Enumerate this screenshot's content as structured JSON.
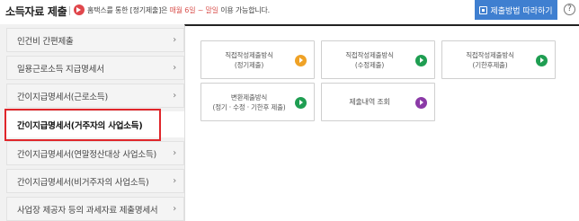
{
  "header": {
    "title": "소득자료 제출",
    "notice": {
      "prefix": "홈택스를 통한 [정기제출]은 ",
      "highlight": "매월 6일 ~ 말일",
      "suffix": " 이용 가능합니다."
    },
    "method_button": "제출방법 따라하기",
    "help_icon": "?"
  },
  "sidebar": {
    "items": [
      {
        "label": "인건비 간편제출",
        "active": false
      },
      {
        "label": "일용근로소득 지급명세서",
        "active": false
      },
      {
        "label": "간이지급명세서(근로소득)",
        "active": false
      },
      {
        "label": "간이지급명세서(거주자의 사업소득)",
        "active": true
      },
      {
        "label": "간이지급명세서(연말정산대상 사업소득)",
        "active": false
      },
      {
        "label": "간이지급명세서(비거주자의 사업소득)",
        "active": false
      },
      {
        "label": "사업장 제공자 등의 과세자료 제출명세서",
        "active": false
      }
    ],
    "chevron": "›"
  },
  "cards": [
    {
      "line1": "직접작성제출방식",
      "line2": "(정기제출)",
      "color": "#efa226"
    },
    {
      "line1": "직접작성제출방식",
      "line2": "(수정제출)",
      "color": "#1f9e52"
    },
    {
      "line1": "직접작성제출방식",
      "line2": "(기한후제출)",
      "color": "#1f9e52"
    },
    {
      "line1": "변환제출방식",
      "line2": "(정기 · 수정 · 기한후 제출)",
      "color": "#1f9e52"
    },
    {
      "line1": "제출내역 조회",
      "line2": "",
      "color": "#8b3aa7"
    }
  ]
}
